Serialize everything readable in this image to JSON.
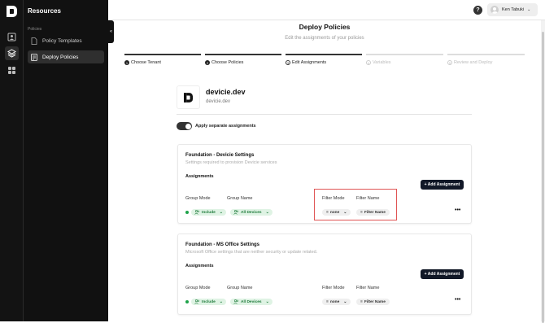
{
  "sidebar": {
    "title": "Resources",
    "section": "Policies",
    "items": [
      {
        "label": "Policy Templates",
        "icon": "file-icon"
      },
      {
        "label": "Deploy Policies",
        "icon": "deploy-icon"
      }
    ],
    "collapse_icon": "«"
  },
  "header": {
    "help_icon": "?",
    "user_name": "Ken Tabuki",
    "chevron": "⌄"
  },
  "page": {
    "title": "Deploy Policies",
    "subtitle": "Edit the assignments of your policies"
  },
  "steps": [
    {
      "num": "1",
      "label": "Choose Tenant",
      "state": "done"
    },
    {
      "num": "2",
      "label": "Choose Policies",
      "state": "done"
    },
    {
      "num": "3",
      "label": "Edit Assignments",
      "state": "current"
    },
    {
      "num": "4",
      "label": "Variables",
      "state": "off"
    },
    {
      "num": "5",
      "label": "Review and Deploy",
      "state": "off"
    }
  ],
  "tenant": {
    "name": "devicie.dev",
    "domain": "devicie.dev"
  },
  "toggle": {
    "label": "Apply separate assignments",
    "on": true
  },
  "cards": [
    {
      "title": "Foundation - Devicie Settings",
      "subtitle": "Settings required to provision Devicie services",
      "assignments_label": "Assignments",
      "add_button": "+ Add Assignment",
      "columns": {
        "group_mode": "Group Mode",
        "group_name": "Group Name",
        "filter_mode": "Filter Mode",
        "filter_name": "Filter Name"
      },
      "row": {
        "mode": "Include",
        "group": "All Devices",
        "filter_mode": "none",
        "filter_name": "Filter Name",
        "more": "•••"
      }
    },
    {
      "title": "Foundation - MS Office Settings",
      "subtitle": "Microsoft Office settings that are neither security or update related.",
      "assignments_label": "Assignments",
      "add_button": "+ Add Assignment",
      "columns": {
        "group_mode": "Group Mode",
        "group_name": "Group Name",
        "filter_mode": "Filter Mode",
        "filter_name": "Filter Name"
      },
      "row": {
        "mode": "Include",
        "group": "All Devices",
        "filter_mode": "none",
        "filter_name": "Filter Name",
        "more": "•••"
      }
    }
  ],
  "colors": {
    "accent": "#111827",
    "include_bg": "#dff3e4",
    "include_fg": "#1d7a3a",
    "highlight": "#e05555"
  }
}
